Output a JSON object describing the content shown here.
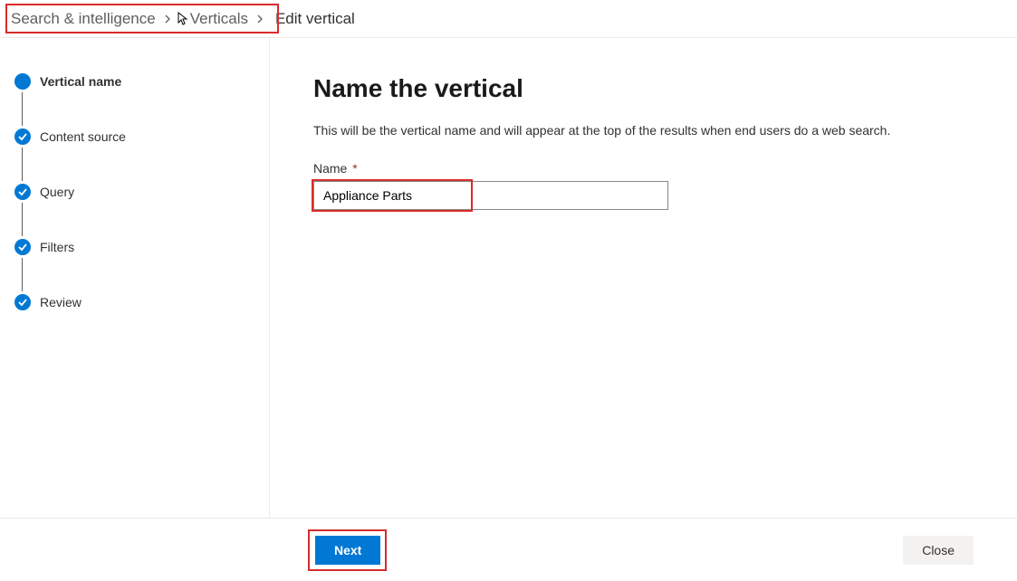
{
  "breadcrumb": {
    "items": [
      {
        "label": "Search & intelligence"
      },
      {
        "label": "Verticals"
      }
    ],
    "current": "Edit vertical"
  },
  "steps": [
    {
      "label": "Vertical name",
      "state": "current"
    },
    {
      "label": "Content source",
      "state": "done"
    },
    {
      "label": "Query",
      "state": "done"
    },
    {
      "label": "Filters",
      "state": "done"
    },
    {
      "label": "Review",
      "state": "done"
    }
  ],
  "main": {
    "heading": "Name the vertical",
    "description": "This will be the vertical name and will appear at the top of the results when end users do a web search.",
    "name_label": "Name",
    "name_required_marker": "*",
    "name_value": "Appliance Parts"
  },
  "footer": {
    "next_label": "Next",
    "close_label": "Close"
  },
  "colors": {
    "accent": "#0078d4",
    "highlight": "#d92c2c"
  }
}
